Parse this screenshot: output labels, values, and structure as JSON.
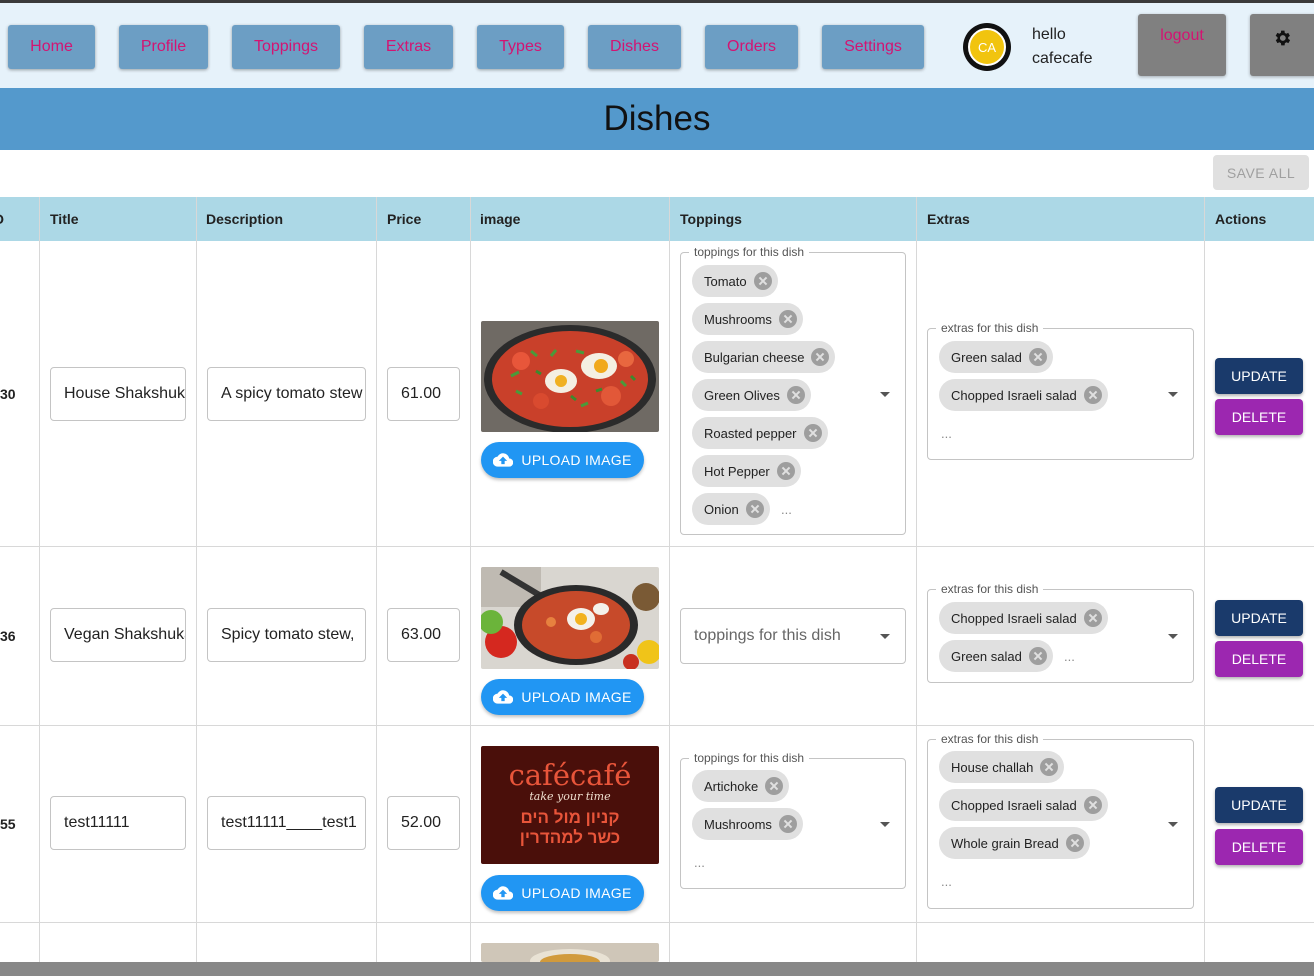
{
  "nav": {
    "home": "Home",
    "profile": "Profile",
    "toppings": "Toppings",
    "extras": "Extras",
    "types": "Types",
    "dishes": "Dishes",
    "orders": "Orders",
    "settings": "Settings",
    "avatar_initials": "CA",
    "greeting_line1": "hello",
    "greeting_line2": "cafecafe",
    "logout": "logout"
  },
  "page_title": "Dishes",
  "save_all": "SAVE ALL",
  "columns": {
    "id": "ID",
    "title": "Title",
    "description": "Description",
    "price": "Price",
    "image": "image",
    "toppings": "Toppings",
    "extras": "Extras",
    "actions": "Actions"
  },
  "toppings_label": "toppings for this dish",
  "extras_label": "extras for this dish",
  "ellipsis": "...",
  "upload_label": "UPLOAD IMAGE",
  "update_label": "UPDATE",
  "delete_label": "DELETE",
  "rows": [
    {
      "id_visible": "30",
      "title": "House Shakshuka",
      "description": "A spicy tomato stew",
      "price": "61.00",
      "toppings": [
        "Tomato",
        "Mushrooms",
        "Bulgarian cheese",
        "Green Olives",
        "Roasted pepper",
        "Hot Pepper",
        "Onion"
      ],
      "extras": [
        "Green salad",
        "Chopped Israeli salad"
      ]
    },
    {
      "id_visible": "36",
      "title": "Vegan Shakshuka",
      "description": "Spicy tomato stew,",
      "price": "63.00",
      "toppings": [],
      "extras": [
        "Chopped Israeli salad",
        "Green salad"
      ]
    },
    {
      "id_visible": "55",
      "title": "test11111",
      "description": "test11111____test1",
      "price": "52.00",
      "toppings": [
        "Artichoke",
        "Mushrooms"
      ],
      "extras": [
        "House challah",
        "Chopped Israeli salad",
        "Whole grain Bread"
      ]
    }
  ],
  "logo": {
    "brand": "cafécafé",
    "tagline": "take your time",
    "line1": "קניון מול הים",
    "line2": "כשר למהדרין"
  },
  "colors": {
    "nav_bg": "#e6f2fa",
    "nav_button": "#6c9ec4",
    "nav_text": "#d31472",
    "title_bar": "#5499cc",
    "table_header": "#acd8e6",
    "upload": "#2196f3",
    "update": "#1a3a6b",
    "delete": "#9c27b0"
  }
}
